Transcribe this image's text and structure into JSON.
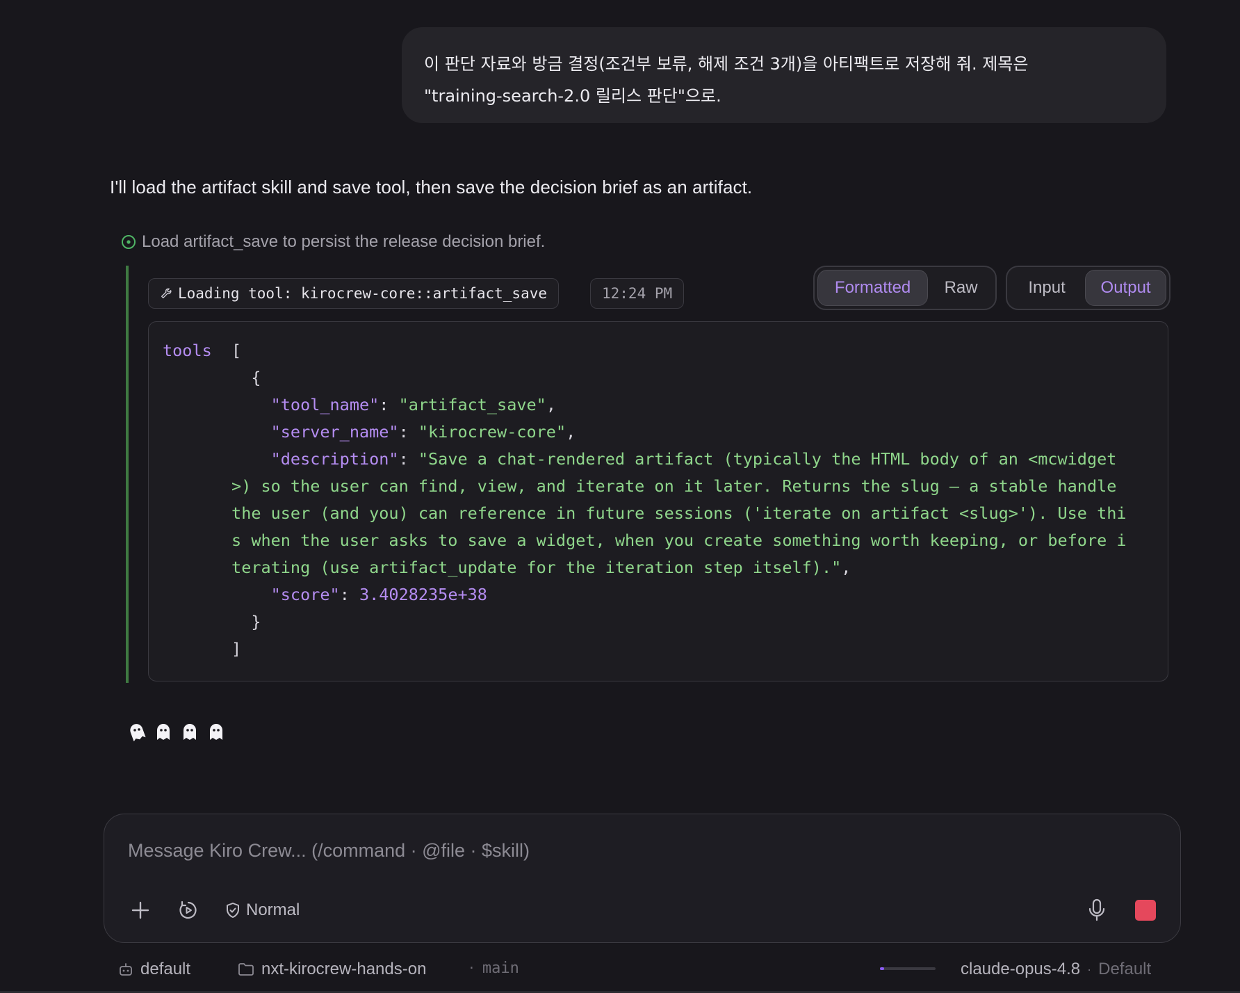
{
  "user_message": {
    "line1": "이 판단 자료와 방금 결정(조건부 보류, 해제 조건 3개)을 아티팩트로 저장해 줘. 제목은",
    "line2": "\"training-search-2.0 릴리스 판단\"으로."
  },
  "assistant": {
    "text": "I'll load the artifact skill and save tool, then save the decision brief as an artifact.",
    "step": "Load artifact_save to persist the release decision brief."
  },
  "tool_call": {
    "title": "Loading tool: kirocrew-core::artifact_save",
    "time": "12:24 PM",
    "view_tabs": [
      "Formatted",
      "Raw"
    ],
    "view_active": "Formatted",
    "io_tabs": [
      "Input",
      "Output"
    ],
    "io_active": "Output",
    "output": {
      "key": "tools",
      "open_bracket": "[",
      "open_brace": "{",
      "close_brace": "}",
      "close_bracket": "]",
      "tool_name_key": "\"tool_name\"",
      "tool_name_val": "\"artifact_save\"",
      "server_name_key": "\"server_name\"",
      "server_name_val": "\"kirocrew-core\"",
      "description_key": "\"description\"",
      "description_lines": [
        "\"Save a chat-rendered artifact (typically the HTML body of an <mcwidget",
        ">) so the user can find, view, and iterate on it later. Returns the slug — a stable handle",
        "the user (and you) can reference in future sessions ('iterate on artifact <slug>'). Use thi",
        "s when the user asks to save a widget, when you create something worth keeping, or before i",
        "terating (use artifact_update for the iteration step itself).\""
      ],
      "score_key": "\"score\"",
      "score_val": "3.4028235e+38"
    }
  },
  "composer": {
    "placeholder": "Message Kiro Crew... (/command · @file · $skill)",
    "mode": "Normal"
  },
  "status_bar": {
    "agent": "default",
    "project": "nxt-kirocrew-hands-on",
    "branch_sep": "·",
    "branch": "main",
    "context_fraction": 0.08,
    "model": "claude-opus-4.8",
    "model_sep": "·",
    "profile": "Default"
  },
  "colors": {
    "accent": "#b08bf0",
    "string": "#8fd68b",
    "tool_border": "#3f7a42",
    "stop": "#e5485c"
  }
}
